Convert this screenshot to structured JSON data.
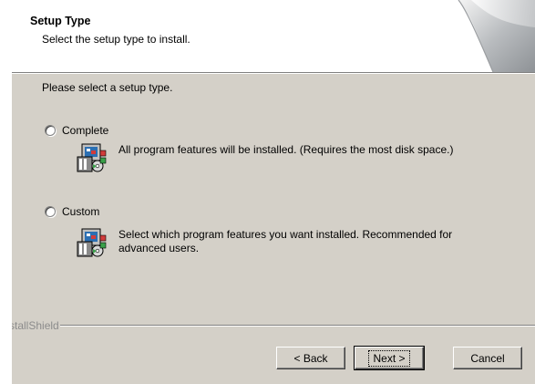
{
  "header": {
    "title": "Setup Type",
    "subtitle": "Select the setup type to install."
  },
  "main": {
    "prompt": "Please select a setup type.",
    "options": [
      {
        "label": "Complete",
        "description": "All program features will be installed. (Requires the most disk space.)",
        "selected": false,
        "icon": "setup-computer-icon"
      },
      {
        "label": "Custom",
        "description": "Select which program features you want installed. Recommended for advanced users.",
        "selected": false,
        "icon": "setup-computer-icon"
      }
    ]
  },
  "footer": {
    "brand": "InstallShield",
    "back_label": "< Back",
    "next_label": "Next >",
    "cancel_label": "Cancel"
  },
  "colors": {
    "dialog_bg": "#d4d0c8",
    "banner_bg": "#ffffff",
    "brand_text": "#8c8c8c"
  }
}
